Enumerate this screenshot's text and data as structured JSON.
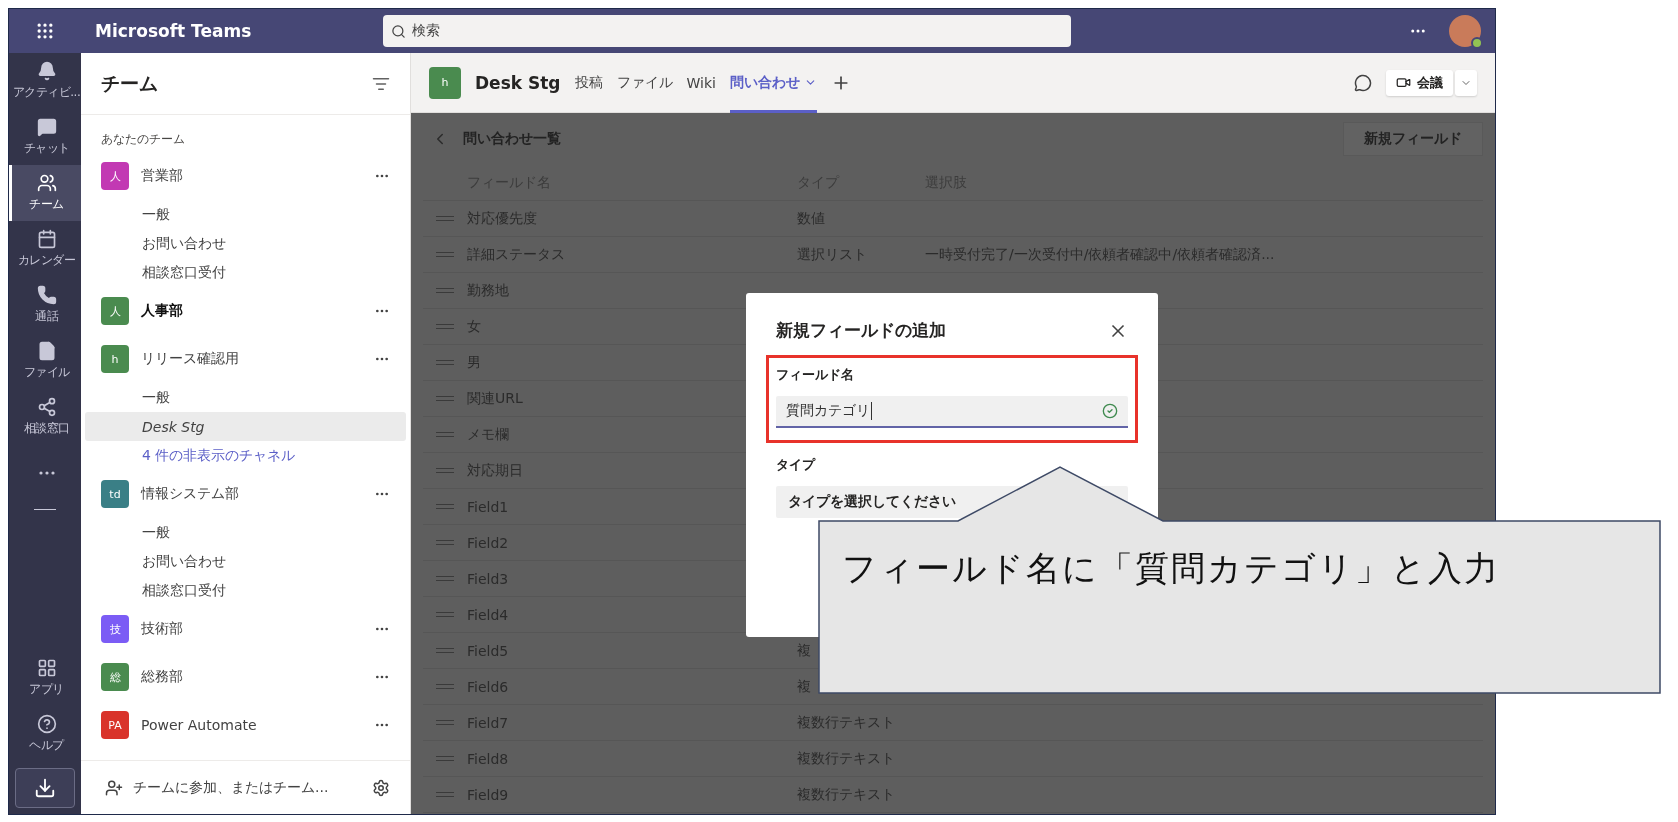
{
  "app_bar": {
    "title": "Microsoft Teams",
    "search_placeholder": "検索"
  },
  "rail": [
    {
      "kind": "bell",
      "label": "アクティビ...",
      "selected": false
    },
    {
      "kind": "chat",
      "label": "チャット",
      "selected": false
    },
    {
      "kind": "teams",
      "label": "チーム",
      "selected": true
    },
    {
      "kind": "calendar",
      "label": "カレンダー",
      "selected": false
    },
    {
      "kind": "call",
      "label": "通話",
      "selected": false
    },
    {
      "kind": "file",
      "label": "ファイル",
      "selected": false
    },
    {
      "kind": "share",
      "label": "相談窓口",
      "selected": false
    }
  ],
  "rail_bottom": [
    {
      "kind": "apps",
      "label": "アプリ"
    },
    {
      "kind": "help",
      "label": "ヘルプ"
    }
  ],
  "sidebar": {
    "title": "チーム",
    "section": "あなたのチーム",
    "teams": [
      {
        "avatar": "人",
        "color": "#c239b3",
        "name": "営業部",
        "unread": false,
        "channels": [
          {
            "kind": "channel",
            "name": "一般",
            "selected": false
          },
          {
            "kind": "channel",
            "name": "お問い合わせ",
            "selected": false
          },
          {
            "kind": "channel",
            "name": "相談窓口受付",
            "selected": false
          }
        ]
      },
      {
        "avatar": "人",
        "color": "#4a8b4f",
        "name": "人事部",
        "unread": true
      },
      {
        "avatar": "h",
        "color": "#4a8b4f",
        "name": "リリース確認用",
        "unread": false,
        "channels": [
          {
            "kind": "channel",
            "name": "一般",
            "selected": false
          },
          {
            "kind": "channel",
            "name": "Desk Stg",
            "selected": true
          },
          {
            "kind": "link",
            "name": "4 件の非表示のチャネル",
            "selected": false
          }
        ]
      },
      {
        "avatar": "td",
        "color": "#3a7f86",
        "name": "情報システム部",
        "unread": false,
        "channels": [
          {
            "kind": "channel",
            "name": "一般",
            "selected": false
          },
          {
            "kind": "channel",
            "name": "お問い合わせ",
            "selected": false
          },
          {
            "kind": "channel",
            "name": "相談窓口受付",
            "selected": false
          }
        ]
      },
      {
        "avatar": "技",
        "color": "#7b5cf5",
        "name": "技術部",
        "unread": false
      },
      {
        "avatar": "総",
        "color": "#4a8b4f",
        "name": "総務部",
        "unread": false
      },
      {
        "avatar": "PA",
        "color": "#d9342b",
        "name": "Power Automate",
        "unread": false
      }
    ],
    "footer": "チームに参加、またはチーム..."
  },
  "channel_header": {
    "avatar": "h",
    "name": "Desk Stg",
    "tabs": [
      {
        "label": "投稿",
        "selected": false
      },
      {
        "label": "ファイル",
        "selected": false
      },
      {
        "label": "Wiki",
        "selected": false
      },
      {
        "label": "問い合わせ",
        "selected": true
      }
    ],
    "meeting": "会議"
  },
  "page": {
    "title": "問い合わせ一覧",
    "new_button": "新規フィールド",
    "columns": [
      "フィールド名",
      "タイプ",
      "選択肢"
    ],
    "rows": [
      {
        "name": "対応優先度",
        "type": "数値"
      },
      {
        "name": "詳細ステータス",
        "type": "選択リスト",
        "options": "一時受付完了/一次受付中/依頼者確認中/依頼者確認済..."
      },
      {
        "name": "勤務地"
      },
      {
        "name": "女"
      },
      {
        "name": "男"
      },
      {
        "name": "関連URL"
      },
      {
        "name": "メモ欄"
      },
      {
        "name": "対応期日"
      },
      {
        "name": "Field1"
      },
      {
        "name": "Field2"
      },
      {
        "name": "Field3"
      },
      {
        "name": "Field4"
      },
      {
        "name": "Field5",
        "type": "複"
      },
      {
        "name": "Field6",
        "type": "複"
      },
      {
        "name": "Field7",
        "type": "複数行テキスト"
      },
      {
        "name": "Field8",
        "type": "複数行テキスト"
      },
      {
        "name": "Field9",
        "type": "複数行テキスト"
      }
    ]
  },
  "dialog": {
    "title": "新規フィールドの追加",
    "field_label": "フィールド名",
    "field_value": "質問カテゴリ",
    "valid": true,
    "type_label": "タイプ",
    "type_placeholder": "タイプを選択してください"
  },
  "callout": {
    "text": "フィールド名に「質問カテゴリ」と入力"
  }
}
